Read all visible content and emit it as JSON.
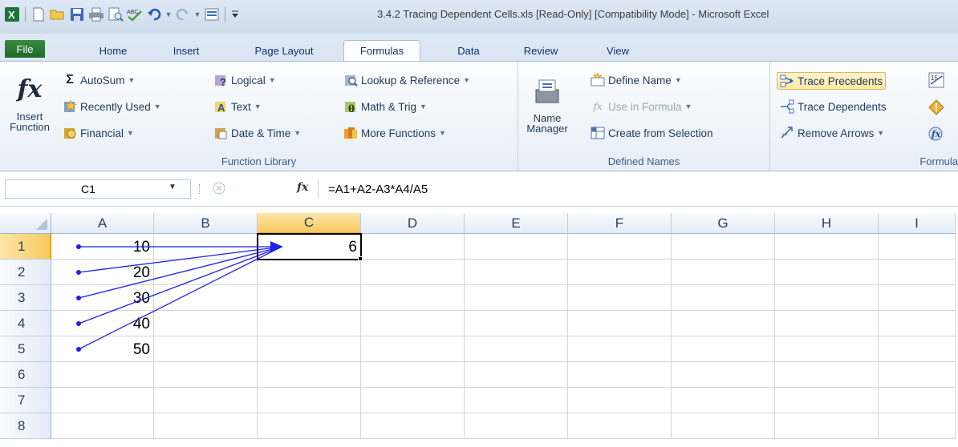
{
  "window": {
    "title": "3.4.2 Tracing Dependent Cells.xls  [Read-Only]  [Compatibility Mode]  -  Microsoft Excel"
  },
  "quick_access": {
    "icons": [
      "excel-app-icon",
      "new-icon",
      "open-icon",
      "save-icon",
      "print-icon",
      "print-preview-icon",
      "spelling-icon",
      "undo-icon",
      "redo-icon",
      "form-icon",
      "customize-icon"
    ]
  },
  "tabs": {
    "file": "File",
    "home": "Home",
    "insert": "Insert",
    "page_layout": "Page Layout",
    "formulas": "Formulas",
    "data": "Data",
    "review": "Review",
    "view": "View"
  },
  "ribbon": {
    "insert_function": {
      "line1": "Insert",
      "line2": "Function"
    },
    "function_library": {
      "autosum": "AutoSum",
      "recently_used": "Recently Used",
      "financial": "Financial",
      "logical": "Logical",
      "text": "Text",
      "date_time": "Date & Time",
      "lookup_reference": "Lookup & Reference",
      "math_trig": "Math & Trig",
      "more_functions": "More Functions",
      "label": "Function Library"
    },
    "defined_names": {
      "name_manager_1": "Name",
      "name_manager_2": "Manager",
      "define_name": "Define Name",
      "use_in_formula": "Use in Formula",
      "create_from_selection": "Create from Selection",
      "label": "Defined Names"
    },
    "formula_auditing": {
      "trace_precedents": "Trace Precedents",
      "trace_dependents": "Trace Dependents",
      "remove_arrows": "Remove Arrows",
      "label": "Formula"
    }
  },
  "formula_bar": {
    "name_box": "C1",
    "fx": "fx",
    "formula": "=A1+A2-A3*A4/A5"
  },
  "sheet": {
    "columns": [
      "A",
      "B",
      "C",
      "D",
      "E",
      "F",
      "G",
      "H",
      "I"
    ],
    "rows": [
      "1",
      "2",
      "3",
      "4",
      "5",
      "6",
      "7",
      "8"
    ],
    "selected_column": "C",
    "selected_row": "1",
    "cells": {
      "A1": "10",
      "A2": "20",
      "A3": "30",
      "A4": "40",
      "A5": "50",
      "C1": "6"
    },
    "arrow_color": "#1f1fe6"
  },
  "colors": {
    "accent": "#e8a41e",
    "file_tab": "#1f6b25",
    "ribbon_text": "#1e395b"
  }
}
